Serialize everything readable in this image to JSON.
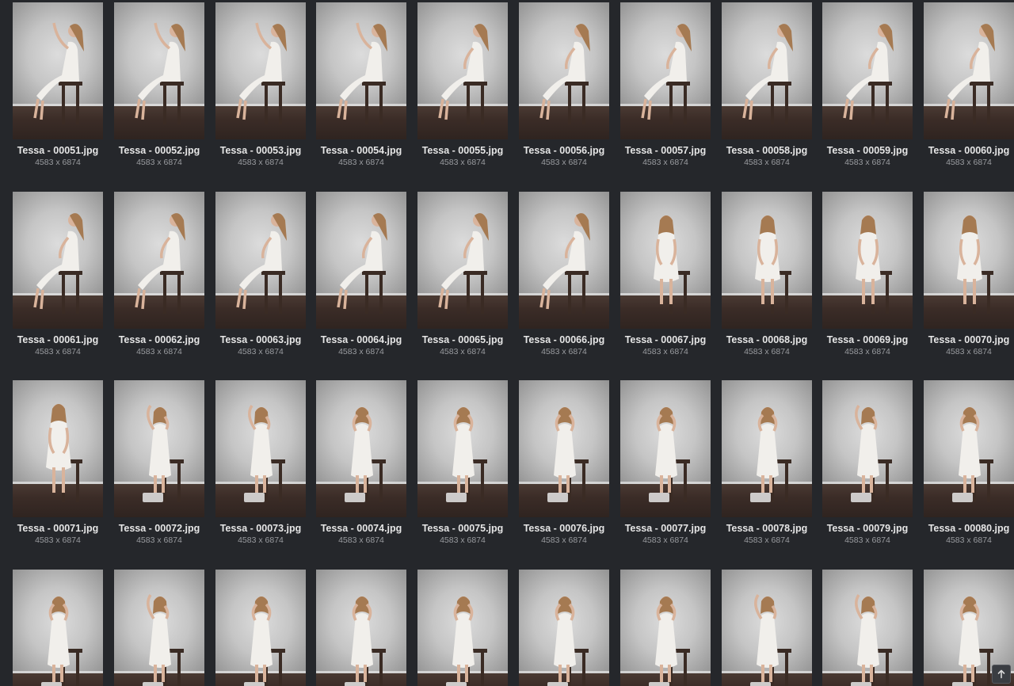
{
  "gallery": {
    "items": [
      {
        "name": "Tessa - 00051.jpg",
        "dims": "4583 x 6874",
        "pose": "sit-side-arm-up"
      },
      {
        "name": "Tessa - 00052.jpg",
        "dims": "4583 x 6874",
        "pose": "sit-side-arm-up"
      },
      {
        "name": "Tessa - 00053.jpg",
        "dims": "4583 x 6874",
        "pose": "sit-side-arm-up"
      },
      {
        "name": "Tessa - 00054.jpg",
        "dims": "4583 x 6874",
        "pose": "sit-side-arm-up"
      },
      {
        "name": "Tessa - 00055.jpg",
        "dims": "4583 x 6874",
        "pose": "sit-side"
      },
      {
        "name": "Tessa - 00056.jpg",
        "dims": "4583 x 6874",
        "pose": "sit-side"
      },
      {
        "name": "Tessa - 00057.jpg",
        "dims": "4583 x 6874",
        "pose": "sit-side"
      },
      {
        "name": "Tessa - 00058.jpg",
        "dims": "4583 x 6874",
        "pose": "sit-side"
      },
      {
        "name": "Tessa - 00059.jpg",
        "dims": "4583 x 6874",
        "pose": "sit-side"
      },
      {
        "name": "Tessa - 00060.jpg",
        "dims": "4583 x 6874",
        "pose": "sit-side"
      },
      {
        "name": "Tessa - 00061.jpg",
        "dims": "4583 x 6874",
        "pose": "sit-side"
      },
      {
        "name": "Tessa - 00062.jpg",
        "dims": "4583 x 6874",
        "pose": "sit-side"
      },
      {
        "name": "Tessa - 00063.jpg",
        "dims": "4583 x 6874",
        "pose": "sit-side"
      },
      {
        "name": "Tessa - 00064.jpg",
        "dims": "4583 x 6874",
        "pose": "sit-side"
      },
      {
        "name": "Tessa - 00065.jpg",
        "dims": "4583 x 6874",
        "pose": "sit-side"
      },
      {
        "name": "Tessa - 00066.jpg",
        "dims": "4583 x 6874",
        "pose": "sit-side"
      },
      {
        "name": "Tessa - 00067.jpg",
        "dims": "4583 x 6874",
        "pose": "sit-front"
      },
      {
        "name": "Tessa - 00068.jpg",
        "dims": "4583 x 6874",
        "pose": "sit-front"
      },
      {
        "name": "Tessa - 00069.jpg",
        "dims": "4583 x 6874",
        "pose": "sit-front"
      },
      {
        "name": "Tessa - 00070.jpg",
        "dims": "4583 x 6874",
        "pose": "sit-front"
      },
      {
        "name": "Tessa - 00071.jpg",
        "dims": "4583 x 6874",
        "pose": "sit-front"
      },
      {
        "name": "Tessa - 00072.jpg",
        "dims": "4583 x 6874",
        "pose": "perch-arm-up"
      },
      {
        "name": "Tessa - 00073.jpg",
        "dims": "4583 x 6874",
        "pose": "perch-arm-up"
      },
      {
        "name": "Tessa - 00074.jpg",
        "dims": "4583 x 6874",
        "pose": "perch-hands-face"
      },
      {
        "name": "Tessa - 00075.jpg",
        "dims": "4583 x 6874",
        "pose": "perch-hands-face"
      },
      {
        "name": "Tessa - 00076.jpg",
        "dims": "4583 x 6874",
        "pose": "perch-hands-face"
      },
      {
        "name": "Tessa - 00077.jpg",
        "dims": "4583 x 6874",
        "pose": "perch-hands-face"
      },
      {
        "name": "Tessa - 00078.jpg",
        "dims": "4583 x 6874",
        "pose": "perch-hands-face"
      },
      {
        "name": "Tessa - 00079.jpg",
        "dims": "4583 x 6874",
        "pose": "perch-arm-up"
      },
      {
        "name": "Tessa - 00080.jpg",
        "dims": "4583 x 6874",
        "pose": "perch-hands-face"
      },
      {
        "name": "",
        "dims": "",
        "pose": "perch-hands-face"
      },
      {
        "name": "",
        "dims": "",
        "pose": "perch-arm-up"
      },
      {
        "name": "",
        "dims": "",
        "pose": "perch-hands-face"
      },
      {
        "name": "",
        "dims": "",
        "pose": "perch-hands-face"
      },
      {
        "name": "",
        "dims": "",
        "pose": "perch-hands-face"
      },
      {
        "name": "",
        "dims": "",
        "pose": "perch-hands-face"
      },
      {
        "name": "",
        "dims": "",
        "pose": "perch-hands-face"
      },
      {
        "name": "",
        "dims": "",
        "pose": "perch-arm-up"
      },
      {
        "name": "",
        "dims": "",
        "pose": "perch-arm-up"
      },
      {
        "name": "",
        "dims": "",
        "pose": "perch-hands-face"
      }
    ]
  },
  "scroll_top": {
    "icon": "arrow-up-icon"
  },
  "colors": {
    "background": "#25272b",
    "filename_text": "#e6e6e6",
    "dims_text": "#9a9ca0"
  }
}
